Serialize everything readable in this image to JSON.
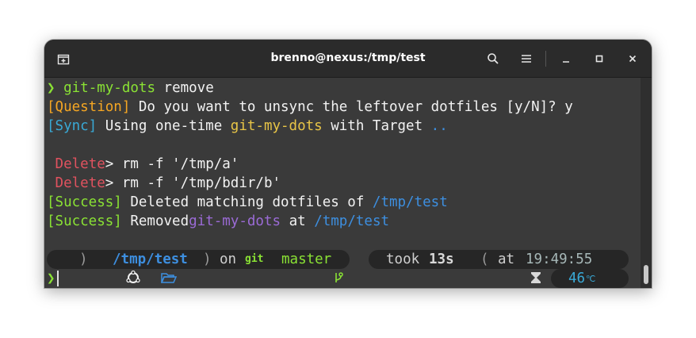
{
  "window": {
    "title": "brenno@nexus:/tmp/test"
  },
  "lines": {
    "l1": {
      "prompt": "❯",
      "cmd": "git-my-dots",
      "arg": " remove"
    },
    "l2": {
      "tag": "[Question]",
      "text": " Do you want to unsync the leftover dotfiles [y/N]? y"
    },
    "l3": {
      "tag": "[Sync]",
      "text1": " Using one-time ",
      "name": "git-my-dots",
      "text2": " with Target ",
      "path": ".."
    },
    "l5": {
      "tag": "Delete",
      "text": "> rm -f '/tmp/a'"
    },
    "l6": {
      "tag": "Delete",
      "text": "> rm -f '/tmp/bdir/b'"
    },
    "l7": {
      "tag": "[Success]",
      "text": " Deleted matching dotfiles of ",
      "path": "/tmp/test"
    },
    "l8": {
      "tag": "[Success]",
      "text1": " Removed",
      "name": "git-my-dots",
      "text2": " at ",
      "path": "/tmp/test"
    }
  },
  "prompt_bar": {
    "os_icon": "ubuntu-icon",
    "folder_icon": "folder-open-icon",
    "dir_sep1": "/",
    "dir_parent": "tmp",
    "dir_sep2": "/",
    "dir_current": "test",
    "on": "on",
    "git_label": "git",
    "branch_icon": "branch-icon",
    "branch": "master",
    "took": "took",
    "duration": "13s",
    "hourglass_icon": "hourglass-icon",
    "at": "at",
    "time": "19:49:55",
    "clock_icon": "clock-icon",
    "temperature": "46",
    "temperature_unit": "℃",
    "cube_icon": "cube-icon",
    "input_prompt": "❯"
  },
  "colors": {
    "green": "#8ae234",
    "orange": "#f5a623",
    "cyan": "#39a9d6",
    "yellow": "#e8c547",
    "red": "#e0525f",
    "blue": "#3d8fe0",
    "purple": "#9b6bd6"
  }
}
